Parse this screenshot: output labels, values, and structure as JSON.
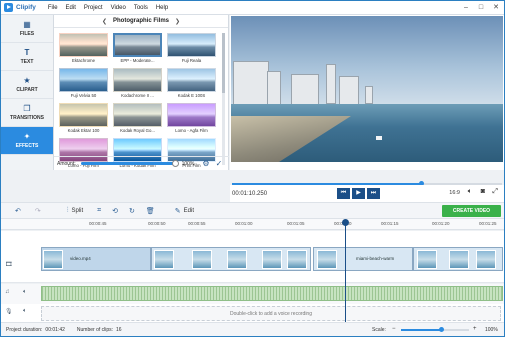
{
  "app": {
    "name": "Clipify"
  },
  "menu": [
    "File",
    "Edit",
    "Project",
    "Video",
    "Tools",
    "Help"
  ],
  "nav": [
    {
      "label": "FILES",
      "icon": "grid-icon"
    },
    {
      "label": "TEXT",
      "icon": "text-icon"
    },
    {
      "label": "CLIPART",
      "icon": "star-icon"
    },
    {
      "label": "TRANSITIONS",
      "icon": "transitions-icon"
    },
    {
      "label": "EFFECTS",
      "icon": "magic-wand-icon",
      "active": true
    }
  ],
  "filters": {
    "title": "Photographic Films",
    "items": [
      "Ektachrome",
      "EPP - Moderate...",
      "Fuji Reala",
      "Fuji Velvia 50",
      "Kodachrome II ...",
      "Kodak E 100S",
      "Kodak Ektar 100",
      "Kodak Royal Go...",
      "Lomo - Agfa Film",
      "Lomo - Fuji Film",
      "Lomo - Kodak Film",
      "Print Film"
    ],
    "selected": 1,
    "amount_label": "Amount:",
    "amount_value": "100%",
    "amount_fraction": 1.0
  },
  "preview": {
    "timecode": "00:01:10.250",
    "aspect": "16:9",
    "progress": 0.7
  },
  "toolbar": {
    "split": "Split",
    "edit": "Edit",
    "create": "CREATE VIDEO"
  },
  "ruler": [
    "00:00:45",
    "00:00:50",
    "00:00:55",
    "00:01:00",
    "00:01:05",
    "00:01:10",
    "00:01:15",
    "00:01:20",
    "00:01:25"
  ],
  "timeline": {
    "clip1": "video.mp4",
    "clip2": "miami-beach-warm",
    "voice_hint": "Double-click to add a voice recording"
  },
  "status": {
    "duration_label": "Project duration:",
    "duration": "00:01:42",
    "clips_label": "Number of clips:",
    "clips": "16",
    "scale_label": "Scale:",
    "scale": "100%"
  }
}
